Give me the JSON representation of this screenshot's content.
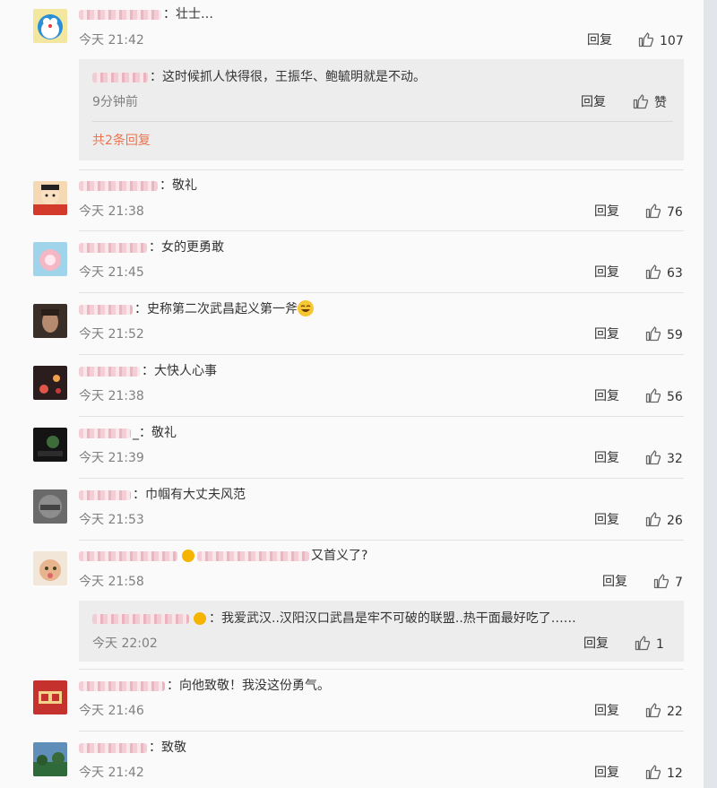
{
  "comments": [
    {
      "text": "：壮士…",
      "time": "今天 21:42",
      "reply": "回复",
      "likes": "107"
    },
    {
      "text": "：敬礼",
      "time": "今天 21:38",
      "reply": "回复",
      "likes": "76"
    },
    {
      "text": "：女的更勇敢",
      "time": "今天 21:45",
      "reply": "回复",
      "likes": "63"
    },
    {
      "text": "：史称第二次武昌起义第一斧",
      "time": "今天 21:52",
      "reply": "回复",
      "likes": "59"
    },
    {
      "text": "：大快人心事",
      "time": "今天 21:38",
      "reply": "回复",
      "likes": "56"
    },
    {
      "text": "_：敬礼",
      "time": "今天 21:39",
      "reply": "回复",
      "likes": "32"
    },
    {
      "text": "：巾帼有大丈夫风范",
      "time": "今天 21:53",
      "reply": "回复",
      "likes": "26"
    },
    {
      "text": "又首义了?",
      "time": "今天 21:58",
      "reply": "回复",
      "likes": "7"
    },
    {
      "text": "：向他致敬！我没这份勇气。",
      "time": "今天 21:46",
      "reply": "回复",
      "likes": "22"
    },
    {
      "text": "：致敬",
      "time": "今天 21:42",
      "reply": "回复",
      "likes": "12"
    }
  ],
  "subreplies": [
    {
      "text": "：这时候抓人快得很，王振华、鲍毓明就是不动。",
      "time": "9分钟前",
      "reply": "回复",
      "likes": "赞",
      "more": "共2条回复"
    },
    {
      "text": "：我爱武汉..汉阳汉口武昌是牢不可破的联盟..热干面最好吃了……",
      "time": "今天 22:02",
      "reply": "回复",
      "likes": "1"
    }
  ],
  "colors": {
    "link": "#eb7350",
    "muted": "#808080",
    "subbox": "#ededed",
    "separator": "#e2e2e2"
  },
  "icons": [
    "thumb-up-icon",
    "laughing-emoji-icon",
    "vip-badge-icon"
  ]
}
